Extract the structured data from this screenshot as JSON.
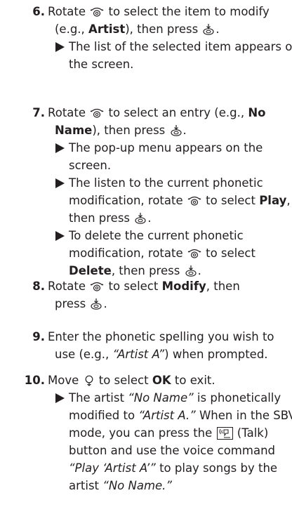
{
  "steps": [
    {
      "num": "6.",
      "lines": [
        [
          "Rotate ",
          "{dial}",
          " to select the item to modify"
        ],
        [
          "(e.g., ",
          "**Artist",
          "), then press ",
          "{press}",
          "."
        ]
      ],
      "results": [
        [
          [
            "The list of the selected item appears on"
          ],
          [
            "the screen."
          ]
        ]
      ]
    },
    {
      "num": "7.",
      "lines": [
        [
          "Rotate ",
          "{dial}",
          " to select an entry (e.g., ",
          "**No"
        ],
        [
          "**Name",
          "), then press ",
          "{press}",
          "."
        ]
      ],
      "results": [
        [
          [
            "The pop-up menu appears on the"
          ],
          [
            "screen."
          ]
        ],
        [
          [
            "The listen to the current phonetic"
          ],
          [
            "modification, rotate ",
            "{dial}",
            " to select ",
            "**Play",
            ","
          ],
          [
            "then press ",
            "{press}",
            "."
          ]
        ],
        [
          [
            "To delete the current phonetic"
          ],
          [
            "modification, rotate ",
            "{dial}",
            " to select"
          ],
          [
            "**Delete",
            ", then press ",
            "{press}",
            "."
          ]
        ]
      ]
    },
    {
      "num": "8.",
      "lines": [
        [
          "Rotate ",
          "{dial}",
          " to select ",
          "**Modify",
          ", then"
        ],
        [
          "press ",
          "{press}",
          "."
        ]
      ],
      "results": []
    },
    {
      "num": "9.",
      "lines": [
        [
          "Enter the phonetic spelling you wish to"
        ],
        [
          "use (e.g., ",
          "//“Artist A”",
          ") when prompted."
        ]
      ],
      "results": []
    },
    {
      "num": "10.",
      "lines": [
        [
          "Move ",
          "{joy}",
          " to select ",
          "**OK",
          " to exit."
        ]
      ],
      "results": [
        [
          [
            "The artist ",
            "//“No Name”",
            " is phonetically"
          ],
          [
            "modified to ",
            "//“Artist A.”",
            " When in the SBV"
          ],
          [
            "mode, you can press the ",
            "{talk}",
            " (Talk)"
          ],
          [
            "button and use the voice command"
          ],
          [
            "//“Play ‘Artist A’”",
            " to play songs by the"
          ],
          [
            "artist ",
            "//“No Name.”"
          ]
        ]
      ]
    }
  ]
}
